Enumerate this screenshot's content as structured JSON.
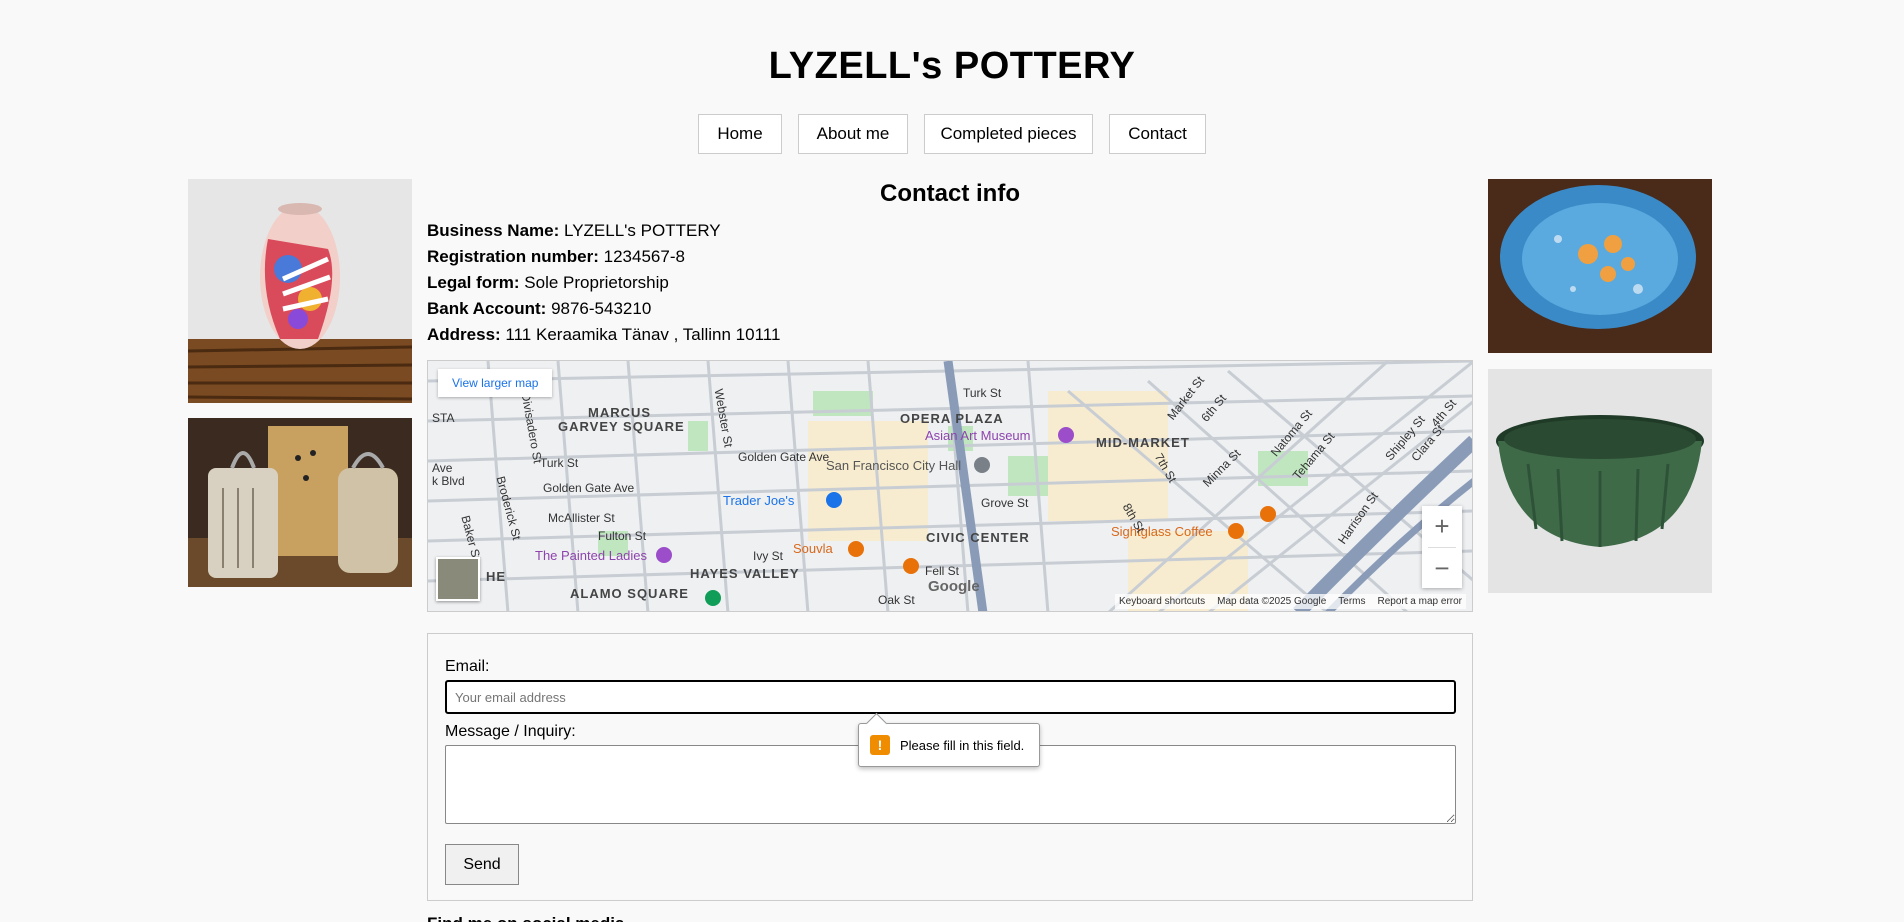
{
  "site": {
    "title": "LYZELL's POTTERY"
  },
  "nav": {
    "items": [
      "Home",
      "About me",
      "Completed pieces",
      "Contact"
    ]
  },
  "contact": {
    "title": "Contact info",
    "business_name_label": "Business Name:",
    "business_name": "LYZELL's POTTERY",
    "registration_label": "Registration number:",
    "registration": "1234567-8",
    "legal_form_label": "Legal form:",
    "legal_form": "Sole Proprietorship",
    "bank_label": "Bank Account:",
    "bank": "9876-543210",
    "address_label": "Address:",
    "address": "111 Keraamika Tänav , Tallinn 10111"
  },
  "map": {
    "larger_map": "View larger map",
    "labels": {
      "marcus": "MARCUS",
      "garvey": "GARVEY SQUARE",
      "opera": "OPERA PLAZA",
      "asian_art": "Asian Art Museum",
      "mid_market": "MID-MARKET",
      "city_hall": "San Francisco City Hall",
      "trader": "Trader Joe's",
      "sightglass": "Sightglass Coffee",
      "civic": "CIVIC CENTER",
      "painted": "The Painted Ladies",
      "souvla": "Souvla",
      "hayes": "HAYES VALLEY",
      "alamo": "ALAMO SQUARE",
      "golden_gate": "Golden Gate Ave",
      "golden_gate2": "Golden Gate Ave",
      "turk": "Turk St",
      "turk2": "Turk St",
      "mcallister": "McAllister St",
      "fulton": "Fulton St",
      "grove": "Grove St",
      "fell": "Fell St",
      "oak": "Oak St",
      "ivy": "Ivy St",
      "webster": "Webster St",
      "harrison": "Harrison St",
      "sta": "STA",
      "ave": "Ave",
      "kblvd": "k Blvd",
      "broderick": "Broderick St",
      "baker": "Baker St",
      "divisadero": "Divisadero St",
      "seventh": "7th St",
      "eighth": "8th St",
      "sixth": "6th St",
      "minna": "Minna St",
      "natoma": "Natoma St",
      "tehama": "Tehama St",
      "market": "Market St",
      "shipley": "Shipley St",
      "clara": "Clara St",
      "fourth": "4th St",
      "he": "HE"
    },
    "zoom_in": "+",
    "zoom_out": "−",
    "google": "Google",
    "attribution": {
      "shortcuts": "Keyboard shortcuts",
      "data": "Map data ©2025 Google",
      "terms": "Terms",
      "report": "Report a map error"
    }
  },
  "form": {
    "email_label": "Email:",
    "email_placeholder": "Your email address",
    "message_label": "Message / Inquiry:",
    "send": "Send"
  },
  "validation": {
    "message": "Please fill in this field."
  },
  "footer": {
    "heading": "Find me on social media"
  },
  "colors": {
    "background": "#f9f9f9",
    "warning": "#f08c00",
    "link": "#1a73e8"
  }
}
